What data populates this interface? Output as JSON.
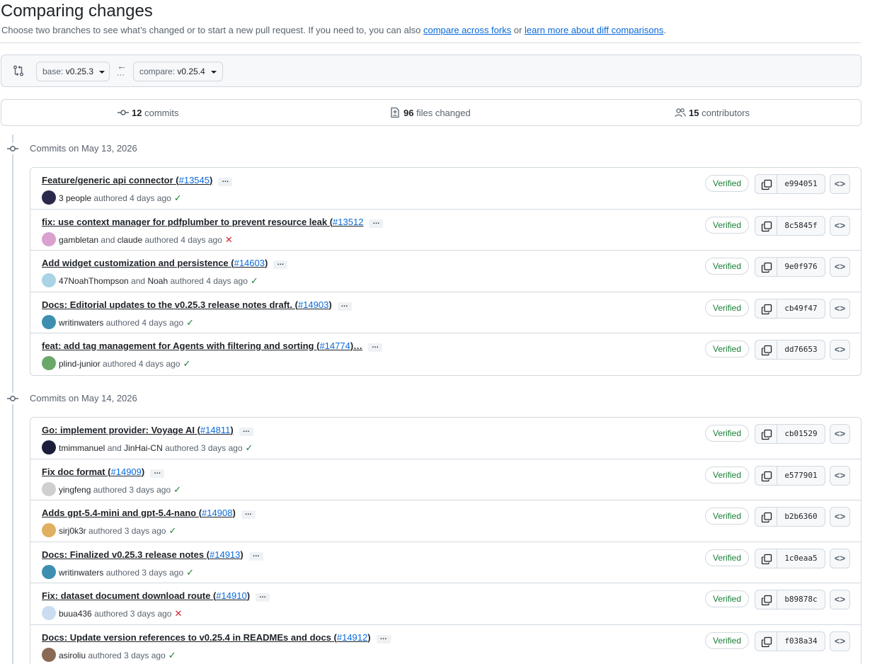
{
  "header": {
    "title": "Comparing changes",
    "subtitle_text": "Choose two branches to see what’s changed or to start a new pull request. If you need to, you can also ",
    "link_forks": "compare across forks",
    "subtitle_or": " or ",
    "link_learn": "learn more about diff comparisons",
    "subtitle_end": "."
  },
  "range": {
    "base_label": "base: ",
    "base_value": "v0.25.3",
    "compare_label": "compare: ",
    "compare_value": "v0.25.4"
  },
  "stats": {
    "commits_count": "12",
    "commits_label": "commits",
    "files_count": "96",
    "files_label": "files changed",
    "contributors_count": "15",
    "contributors_label": "contributors"
  },
  "groups": [
    {
      "date_label": "Commits on May 13, 2026",
      "commits": [
        {
          "title": "Feature/generic api connector (",
          "pr": "#13545",
          "title_end": ")",
          "authors": "3 people",
          "joiner": "",
          "coauthor": "",
          "time": "authored 4 days ago",
          "status": "ok",
          "verified": "Verified",
          "sha": "e994051",
          "avatar_color": "#2b2a4c"
        },
        {
          "title": "fix: use context manager for pdfplumber to prevent resource leak (",
          "pr": "#13512",
          "title_end": "",
          "authors": "gambletan",
          "joiner": "and",
          "coauthor": "claude",
          "time": "authored 4 days ago",
          "status": "fail",
          "verified": "Verified",
          "sha": "8c5845f",
          "avatar_color": "#d9a0d0"
        },
        {
          "title": "Add widget customization and persistence (",
          "pr": "#14603",
          "title_end": ")",
          "authors": "47NoahThompson",
          "joiner": "and",
          "coauthor": "Noah",
          "time": "authored 4 days ago",
          "status": "ok",
          "verified": "Verified",
          "sha": "9e0f976",
          "avatar_color": "#a8d4e6"
        },
        {
          "title": "Docs: Editorial updates to the v0.25.3 release notes draft. (",
          "pr": "#14903",
          "title_end": ")",
          "authors": "writinwaters",
          "joiner": "",
          "coauthor": "",
          "time": "authored 4 days ago",
          "status": "ok",
          "verified": "Verified",
          "sha": "cb49f47",
          "avatar_color": "#3d8fb0"
        },
        {
          "title": "feat: add tag management for Agents with filtering and sorting (",
          "pr": "#14774",
          "title_end": ")…",
          "authors": "plind-junior",
          "joiner": "",
          "coauthor": "",
          "time": "authored 4 days ago",
          "status": "ok",
          "verified": "Verified",
          "sha": "dd76653",
          "avatar_color": "#6aa86a"
        }
      ]
    },
    {
      "date_label": "Commits on May 14, 2026",
      "commits": [
        {
          "title": "Go: implement provider: Voyage AI (",
          "pr": "#14811",
          "title_end": ")",
          "authors": "tmimmanuel",
          "joiner": "and",
          "coauthor": "JinHai-CN",
          "time": "authored 3 days ago",
          "status": "ok",
          "verified": "Verified",
          "sha": "cb01529",
          "avatar_color": "#1a1e3a"
        },
        {
          "title": "Fix doc format (",
          "pr": "#14909",
          "title_end": ")",
          "authors": "yingfeng",
          "joiner": "",
          "coauthor": "",
          "time": "authored 3 days ago",
          "status": "ok",
          "verified": "Verified",
          "sha": "e577901",
          "avatar_color": "#cfcfcf"
        },
        {
          "title": "Adds gpt-5.4-mini and gpt-5.4-nano (",
          "pr": "#14908",
          "title_end": ")",
          "authors": "sirj0k3r",
          "joiner": "",
          "coauthor": "",
          "time": "authored 3 days ago",
          "status": "ok",
          "verified": "Verified",
          "sha": "b2b6360",
          "avatar_color": "#e0b060"
        },
        {
          "title": "Docs: Finalized v0.25.3 release notes (",
          "pr": "#14913",
          "title_end": ")",
          "authors": "writinwaters",
          "joiner": "",
          "coauthor": "",
          "time": "authored 3 days ago",
          "status": "ok",
          "verified": "Verified",
          "sha": "1c0eaa5",
          "avatar_color": "#3d8fb0"
        },
        {
          "title": "Fix: dataset document download route (",
          "pr": "#14910",
          "title_end": ")",
          "authors": "buua436",
          "joiner": "",
          "coauthor": "",
          "time": "authored 3 days ago",
          "status": "fail",
          "verified": "Verified",
          "sha": "b89878c",
          "avatar_color": "#c9dcf0"
        },
        {
          "title": "Docs: Update version references to v0.25.4 in READMEs and docs (",
          "pr": "#14912",
          "title_end": ")",
          "authors": "asiroliu",
          "joiner": "",
          "coauthor": "",
          "time": "authored 3 days ago",
          "status": "ok",
          "verified": "Verified",
          "sha": "f038a34",
          "avatar_color": "#8a6a55"
        }
      ]
    }
  ],
  "icons": {
    "compare": "git-compare-icon",
    "arrow": "arrow-left-icon",
    "commit": "git-commit-icon",
    "file_diff": "file-diff-icon",
    "people": "people-icon",
    "copy": "copy-icon",
    "code": "code-icon",
    "check": "check-icon",
    "x": "x-icon"
  },
  "colors": {
    "link": "#0969da",
    "success": "#1a7f37",
    "danger": "#d1242f",
    "muted": "#59636e",
    "border": "#d1d9e0"
  }
}
